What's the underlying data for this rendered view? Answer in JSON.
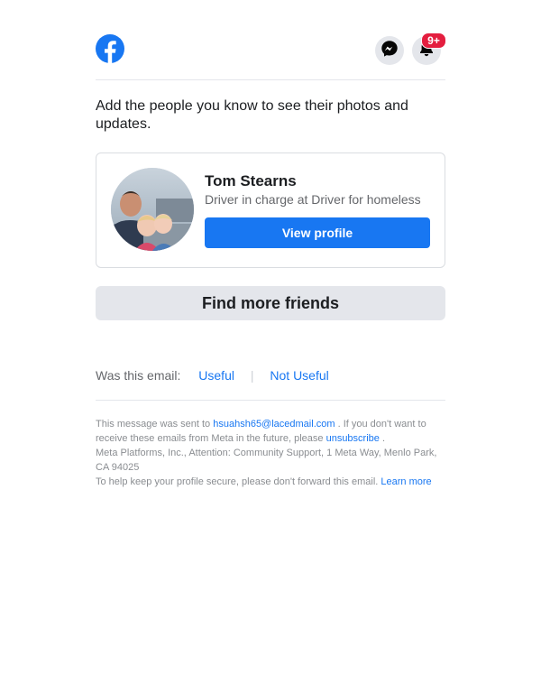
{
  "header": {
    "logo_icon": "facebook-logo-icon",
    "messenger_icon": "messenger-icon",
    "notifications_icon": "bell-icon",
    "notification_badge": "9+",
    "colors": {
      "brand": "#1877f2",
      "badge": "#e41e3f"
    }
  },
  "intro": {
    "text": "Add the people you know to see their photos and updates."
  },
  "suggestion": {
    "name": "Tom Stearns",
    "subtitle": "Driver in charge at Driver for homeless",
    "button_label": "View profile",
    "avatar_icon": "profile-photo"
  },
  "find_more": {
    "label": "Find more friends"
  },
  "feedback": {
    "question": "Was this email:",
    "useful": "Useful",
    "separator": "|",
    "not_useful": "Not Useful"
  },
  "footer": {
    "sent_prefix": "This message was sent to",
    "email": "hsuahsh65@lacedmail.com",
    "sent_suffix": ". If you don't want to receive these emails from Meta in the future, please",
    "unsubscribe": "unsubscribe",
    "period": ".",
    "address": "Meta Platforms, Inc., Attention: Community Support, 1 Meta Way, Menlo Park, CA 94025",
    "secure_text": "To help keep your profile secure, please don't forward this email.",
    "learn_more": "Learn more"
  }
}
